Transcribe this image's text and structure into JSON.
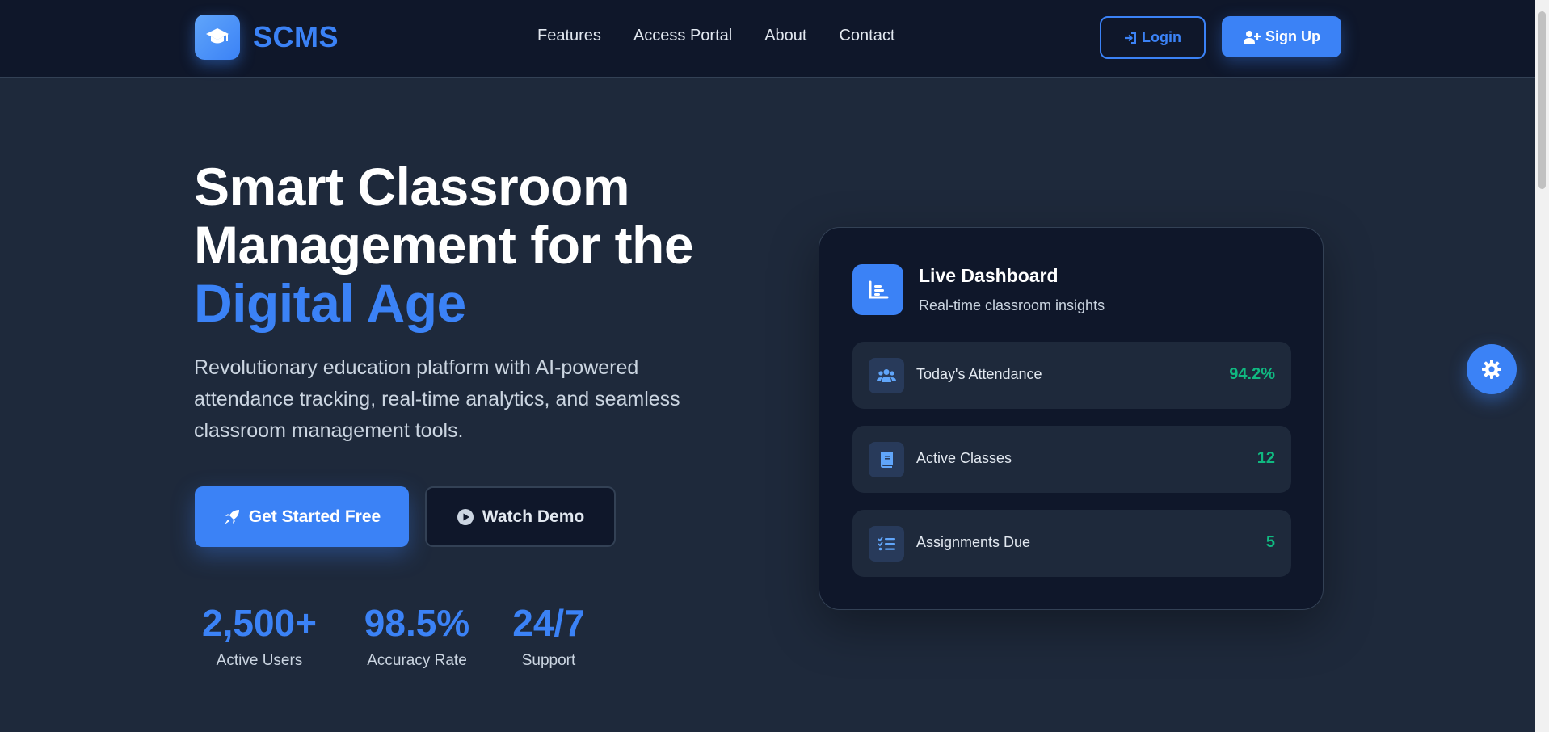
{
  "nav": {
    "brand": "SCMS",
    "brand_icon": "graduation-cap-icon",
    "links": [
      "Features",
      "Access Portal",
      "About",
      "Contact"
    ],
    "login_label": "Login",
    "signup_label": "Sign Up"
  },
  "hero": {
    "title_line1": "Smart Classroom",
    "title_line2": "Management for the",
    "title_accent": "Digital Age",
    "subtitle": "Revolutionary education platform with AI-powered attendance tracking, real-time analytics, and seamless classroom management tools.",
    "cta_primary": "Get Started Free",
    "cta_secondary": "Watch Demo",
    "stats": [
      {
        "value": "2,500+",
        "label": "Active Users"
      },
      {
        "value": "98.5%",
        "label": "Accuracy Rate"
      },
      {
        "value": "24/7",
        "label": "Support"
      }
    ]
  },
  "dashboard": {
    "title": "Live Dashboard",
    "subtitle": "Real-time classroom insights",
    "icon": "chart-icon",
    "metrics": [
      {
        "label": "Today's Attendance",
        "value": "94.2%",
        "icon": "users-icon"
      },
      {
        "label": "Active Classes",
        "value": "12",
        "icon": "book-icon"
      },
      {
        "label": "Assignments Due",
        "value": "5",
        "icon": "checklist-icon"
      }
    ]
  },
  "colors": {
    "background": "#1e293b",
    "navbar": "#0f172a",
    "accent": "#3b82f6",
    "success": "#10b981",
    "text": "#e2e8f0"
  },
  "fab_icon": "gear-icon"
}
